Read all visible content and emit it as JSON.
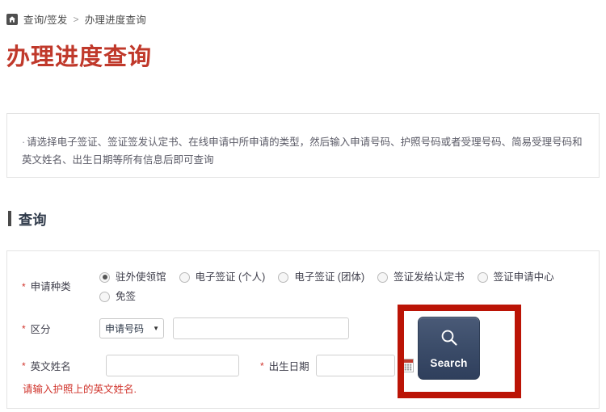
{
  "breadcrumb": {
    "home_icon": "home-icon",
    "items": [
      "查询/签发",
      "办理进度查询"
    ],
    "separator": ">"
  },
  "page_title": "办理进度查询",
  "notice": {
    "bullet": "·",
    "text": "请选择电子签证、签证签发认定书、在线申请中所申请的类型，然后输入申请号码、护照号码或者受理号码、简易受理号码和英文姓名、出生日期等所有信息后即可查询"
  },
  "section": {
    "title": "查询"
  },
  "form": {
    "required_mark": "*",
    "application_type": {
      "label": "申请种类",
      "options": [
        {
          "label": "驻外使领馆",
          "checked": true
        },
        {
          "label": "电子签证 (个人)",
          "checked": false
        },
        {
          "label": "电子签证 (团体)",
          "checked": false
        },
        {
          "label": "签证发给认定书",
          "checked": false
        },
        {
          "label": "签证申请中心",
          "checked": false
        },
        {
          "label": "免签",
          "checked": false
        }
      ]
    },
    "sort": {
      "label": "区分",
      "select_value": "申请号码",
      "select_options": [
        "申请号码"
      ],
      "caret": "▼",
      "input_value": "",
      "input_placeholder": ""
    },
    "english_name": {
      "label": "英文姓名",
      "input_value": "",
      "input_placeholder": ""
    },
    "birth_date": {
      "label": "出生日期",
      "input_value": "",
      "input_placeholder": "",
      "calendar_icon": "calendar-icon"
    },
    "helper_text": "请输入护照上的英文姓名."
  },
  "search_button": {
    "label": "Search",
    "icon": "magnifier-icon"
  },
  "colors": {
    "title_red": "#c0392b",
    "annotation_red": "#bb1406",
    "required_red": "#d0342c",
    "button_navy": "#3d4e6b",
    "section_bar": "#4a4a4a"
  }
}
